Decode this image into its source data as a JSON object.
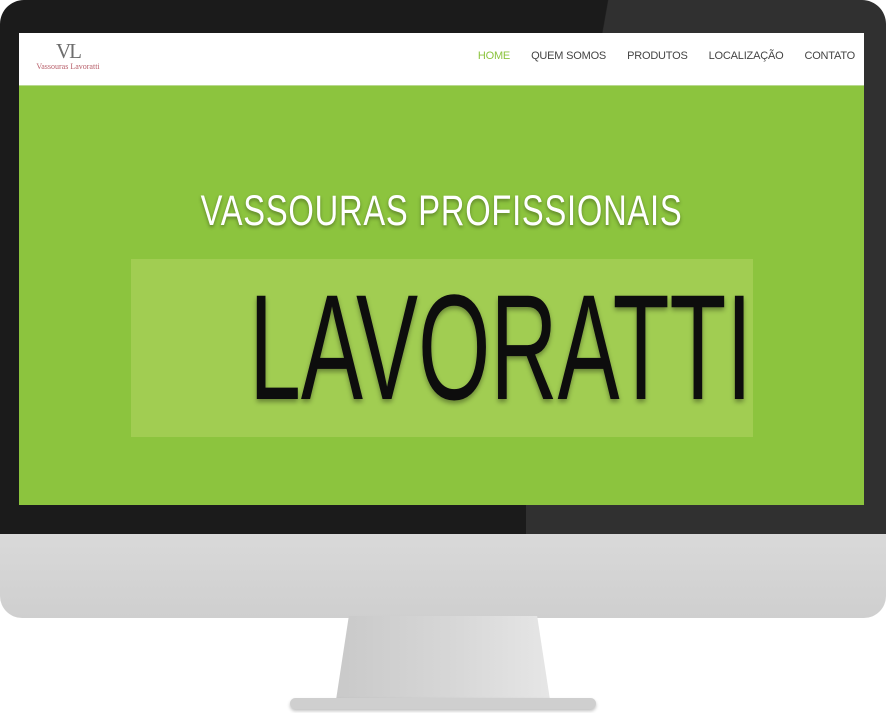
{
  "site": {
    "logo": {
      "monogram": "VL",
      "text": "Vassouras Lavoratti"
    },
    "nav": [
      {
        "label": "HOME",
        "active": true
      },
      {
        "label": "QUEM SOMOS",
        "active": false
      },
      {
        "label": "PRODUTOS",
        "active": false
      },
      {
        "label": "LOCALIZAÇÃO",
        "active": false
      },
      {
        "label": "CONTATO",
        "active": false
      }
    ]
  },
  "hero": {
    "title": "VASSOURAS PROFISSIONAIS",
    "brand": "LAVORATTI"
  },
  "colors": {
    "accent": "#8cc43e",
    "brand_box": "#a1cd52",
    "monitor_bezel": "#1b1b1b"
  }
}
